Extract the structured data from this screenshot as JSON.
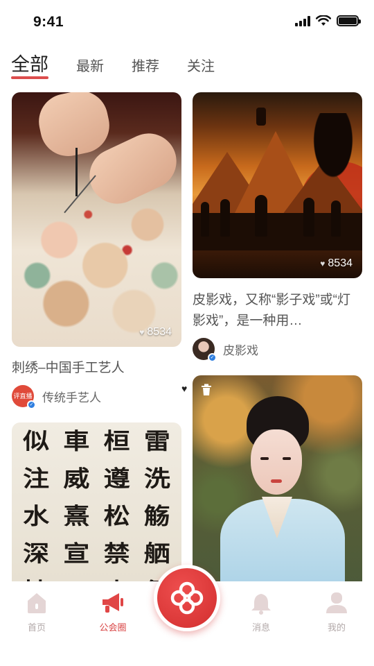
{
  "status_bar": {
    "time": "9:41",
    "signal_icon": "cellular-signal-icon",
    "wifi_icon": "wifi-icon",
    "battery_icon": "battery-full-icon"
  },
  "tabs": [
    {
      "label": "全部",
      "active": true
    },
    {
      "label": "最新",
      "active": false
    },
    {
      "label": "推荐",
      "active": false
    },
    {
      "label": "关注",
      "active": false
    }
  ],
  "feed": {
    "cards": [
      {
        "image_subject": "embroidery-photo",
        "like_count": "8534",
        "title": "刺绣–中国手工艺人",
        "author_name": "传统手艺人",
        "author_avatar_text": "评直播",
        "verified": true
      },
      {
        "image_subject": "shadow-puppet-photo",
        "like_count": "8534",
        "title": "皮影戏，又称“影子戏”或“灯影戏”，是一种用…",
        "author_name": "皮影戏",
        "verified": true
      },
      {
        "image_subject": "calligraphy-photo",
        "calligraphy_chars": [
          "似",
          "車",
          "桓",
          "雷",
          "注",
          "威",
          "遵",
          "洗",
          "水",
          "熹",
          "松",
          "觞",
          "深",
          "宣",
          "禁",
          "舾",
          "持",
          "二",
          "山",
          "佃"
        ]
      },
      {
        "image_subject": "hanfu-portrait-photo",
        "badge_icon": "trash-icon"
      }
    ]
  },
  "bottom_nav": {
    "items": [
      {
        "label": "首页",
        "icon": "home-icon",
        "active": false
      },
      {
        "label": "公会圈",
        "icon": "megaphone-icon",
        "active": true
      },
      {
        "label": "消息",
        "icon": "bell-icon",
        "active": false
      },
      {
        "label": "我的",
        "icon": "user-icon",
        "active": false
      }
    ],
    "center_icon": "chinese-knot-icon"
  },
  "colors": {
    "accent": "#d83a3a",
    "nav_inactive": "#b2a8a8",
    "verified_blue": "#2f7fe0"
  }
}
